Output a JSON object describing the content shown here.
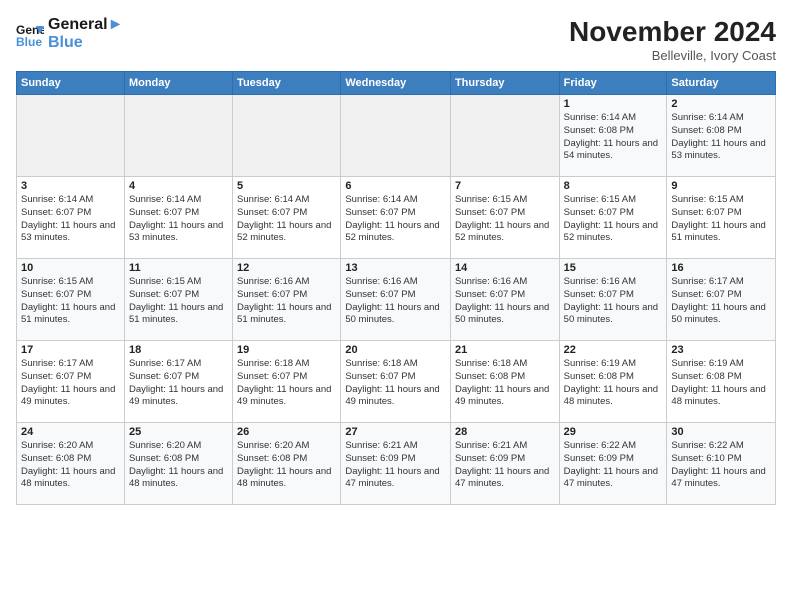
{
  "header": {
    "logo_line1": "General",
    "logo_line2": "Blue",
    "month_title": "November 2024",
    "location": "Belleville, Ivory Coast"
  },
  "days_of_week": [
    "Sunday",
    "Monday",
    "Tuesday",
    "Wednesday",
    "Thursday",
    "Friday",
    "Saturday"
  ],
  "weeks": [
    {
      "days": [
        {
          "num": "",
          "info": ""
        },
        {
          "num": "",
          "info": ""
        },
        {
          "num": "",
          "info": ""
        },
        {
          "num": "",
          "info": ""
        },
        {
          "num": "",
          "info": ""
        },
        {
          "num": "1",
          "info": "Sunrise: 6:14 AM\nSunset: 6:08 PM\nDaylight: 11 hours and 54 minutes."
        },
        {
          "num": "2",
          "info": "Sunrise: 6:14 AM\nSunset: 6:08 PM\nDaylight: 11 hours and 53 minutes."
        }
      ]
    },
    {
      "days": [
        {
          "num": "3",
          "info": "Sunrise: 6:14 AM\nSunset: 6:07 PM\nDaylight: 11 hours and 53 minutes."
        },
        {
          "num": "4",
          "info": "Sunrise: 6:14 AM\nSunset: 6:07 PM\nDaylight: 11 hours and 53 minutes."
        },
        {
          "num": "5",
          "info": "Sunrise: 6:14 AM\nSunset: 6:07 PM\nDaylight: 11 hours and 52 minutes."
        },
        {
          "num": "6",
          "info": "Sunrise: 6:14 AM\nSunset: 6:07 PM\nDaylight: 11 hours and 52 minutes."
        },
        {
          "num": "7",
          "info": "Sunrise: 6:15 AM\nSunset: 6:07 PM\nDaylight: 11 hours and 52 minutes."
        },
        {
          "num": "8",
          "info": "Sunrise: 6:15 AM\nSunset: 6:07 PM\nDaylight: 11 hours and 52 minutes."
        },
        {
          "num": "9",
          "info": "Sunrise: 6:15 AM\nSunset: 6:07 PM\nDaylight: 11 hours and 51 minutes."
        }
      ]
    },
    {
      "days": [
        {
          "num": "10",
          "info": "Sunrise: 6:15 AM\nSunset: 6:07 PM\nDaylight: 11 hours and 51 minutes."
        },
        {
          "num": "11",
          "info": "Sunrise: 6:15 AM\nSunset: 6:07 PM\nDaylight: 11 hours and 51 minutes."
        },
        {
          "num": "12",
          "info": "Sunrise: 6:16 AM\nSunset: 6:07 PM\nDaylight: 11 hours and 51 minutes."
        },
        {
          "num": "13",
          "info": "Sunrise: 6:16 AM\nSunset: 6:07 PM\nDaylight: 11 hours and 50 minutes."
        },
        {
          "num": "14",
          "info": "Sunrise: 6:16 AM\nSunset: 6:07 PM\nDaylight: 11 hours and 50 minutes."
        },
        {
          "num": "15",
          "info": "Sunrise: 6:16 AM\nSunset: 6:07 PM\nDaylight: 11 hours and 50 minutes."
        },
        {
          "num": "16",
          "info": "Sunrise: 6:17 AM\nSunset: 6:07 PM\nDaylight: 11 hours and 50 minutes."
        }
      ]
    },
    {
      "days": [
        {
          "num": "17",
          "info": "Sunrise: 6:17 AM\nSunset: 6:07 PM\nDaylight: 11 hours and 49 minutes."
        },
        {
          "num": "18",
          "info": "Sunrise: 6:17 AM\nSunset: 6:07 PM\nDaylight: 11 hours and 49 minutes."
        },
        {
          "num": "19",
          "info": "Sunrise: 6:18 AM\nSunset: 6:07 PM\nDaylight: 11 hours and 49 minutes."
        },
        {
          "num": "20",
          "info": "Sunrise: 6:18 AM\nSunset: 6:07 PM\nDaylight: 11 hours and 49 minutes."
        },
        {
          "num": "21",
          "info": "Sunrise: 6:18 AM\nSunset: 6:08 PM\nDaylight: 11 hours and 49 minutes."
        },
        {
          "num": "22",
          "info": "Sunrise: 6:19 AM\nSunset: 6:08 PM\nDaylight: 11 hours and 48 minutes."
        },
        {
          "num": "23",
          "info": "Sunrise: 6:19 AM\nSunset: 6:08 PM\nDaylight: 11 hours and 48 minutes."
        }
      ]
    },
    {
      "days": [
        {
          "num": "24",
          "info": "Sunrise: 6:20 AM\nSunset: 6:08 PM\nDaylight: 11 hours and 48 minutes."
        },
        {
          "num": "25",
          "info": "Sunrise: 6:20 AM\nSunset: 6:08 PM\nDaylight: 11 hours and 48 minutes."
        },
        {
          "num": "26",
          "info": "Sunrise: 6:20 AM\nSunset: 6:08 PM\nDaylight: 11 hours and 48 minutes."
        },
        {
          "num": "27",
          "info": "Sunrise: 6:21 AM\nSunset: 6:09 PM\nDaylight: 11 hours and 47 minutes."
        },
        {
          "num": "28",
          "info": "Sunrise: 6:21 AM\nSunset: 6:09 PM\nDaylight: 11 hours and 47 minutes."
        },
        {
          "num": "29",
          "info": "Sunrise: 6:22 AM\nSunset: 6:09 PM\nDaylight: 11 hours and 47 minutes."
        },
        {
          "num": "30",
          "info": "Sunrise: 6:22 AM\nSunset: 6:10 PM\nDaylight: 11 hours and 47 minutes."
        }
      ]
    }
  ]
}
